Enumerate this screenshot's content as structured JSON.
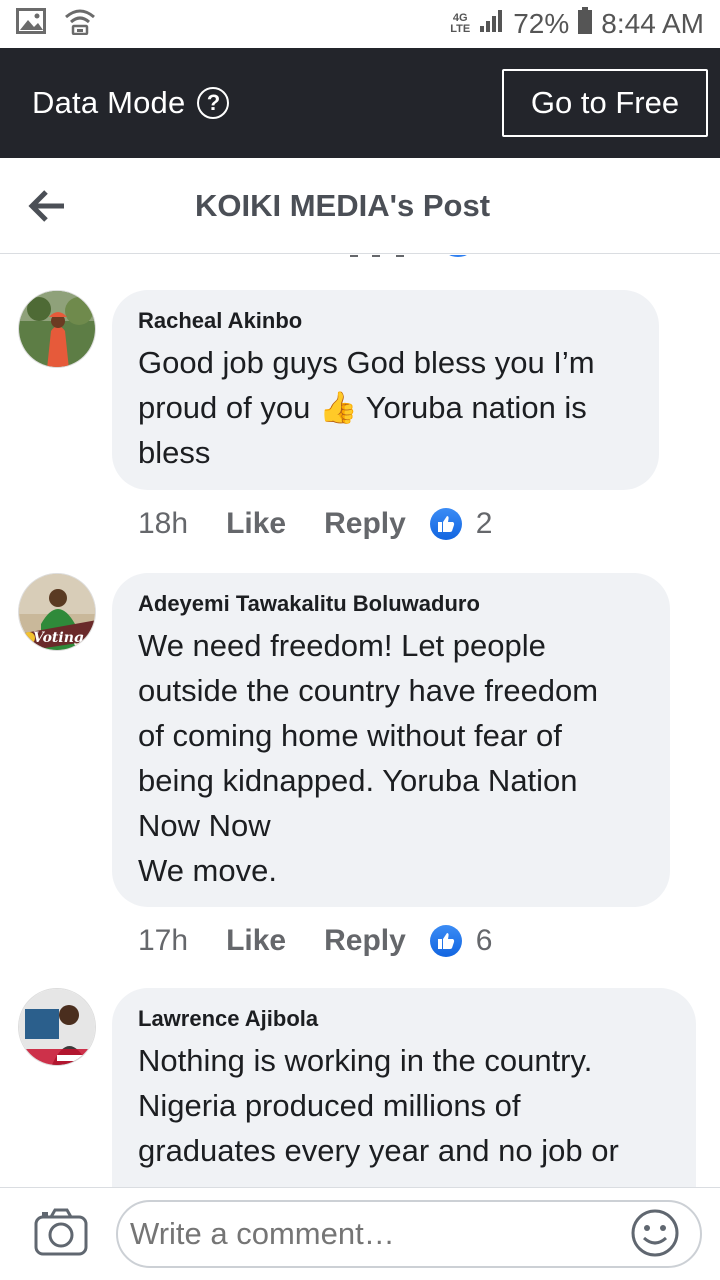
{
  "status_bar": {
    "network": "4G LTE",
    "battery": "72%",
    "time": "8:44 AM"
  },
  "data_mode": {
    "label": "Data Mode",
    "help_symbol": "?",
    "go_to_free": "Go to Free"
  },
  "header": {
    "title": "KOIKI MEDIA's Post"
  },
  "comments": [
    {
      "author": "Racheal Akinbo",
      "text": "Good job guys God bless you I’m\nproud of you 👍 Yoruba nation is\nbless",
      "time": "18h",
      "like": "Like",
      "reply": "Reply",
      "reactions": "2"
    },
    {
      "author": "Adeyemi Tawakalitu Boluwaduro",
      "text": "We need freedom! Let people\noutside the country have freedom\nof coming home without fear of\nbeing kidnapped. Yoruba Nation\nNow Now\nWe move.",
      "time": "17h",
      "like": "Like",
      "reply": "Reply",
      "reactions": "6"
    },
    {
      "author": "Lawrence Ajibola",
      "text": "Nothing is working in the country.\nNigeria produced millions of\ngraduates every year and no job or"
    }
  ],
  "composer": {
    "placeholder": "Write a comment…"
  },
  "colors": {
    "data_bar": "#23252b",
    "bubble": "#f0f2f5",
    "like_blue": "#1877f2"
  }
}
